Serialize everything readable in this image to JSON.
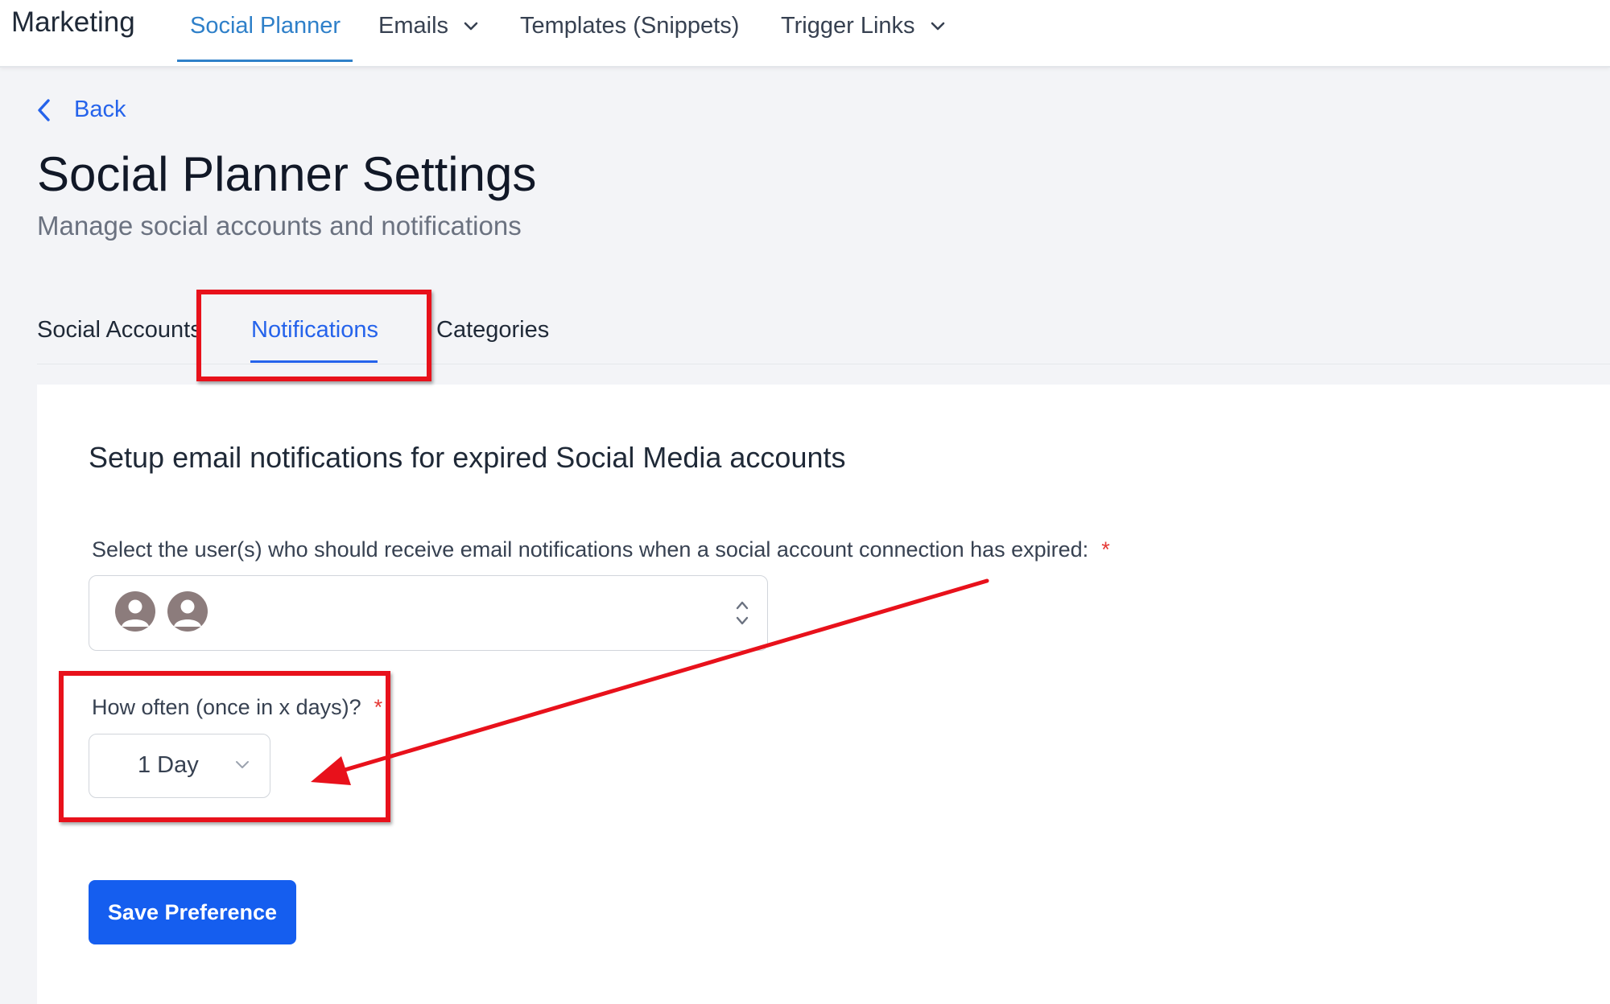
{
  "topbar": {
    "app_title": "Marketing",
    "nav": [
      {
        "label": "Social Planner",
        "active": true,
        "has_dropdown": false
      },
      {
        "label": "Emails",
        "active": false,
        "has_dropdown": true
      },
      {
        "label": "Templates (Snippets)",
        "active": false,
        "has_dropdown": false
      },
      {
        "label": "Trigger Links",
        "active": false,
        "has_dropdown": true
      }
    ]
  },
  "back_label": "Back",
  "page": {
    "title": "Social Planner Settings",
    "subtitle": "Manage social accounts and notifications"
  },
  "tabs": [
    {
      "label": "Social Accounts",
      "active": false
    },
    {
      "label": "Notifications",
      "active": true
    },
    {
      "label": "Categories",
      "active": false
    }
  ],
  "notifications": {
    "heading": "Setup email notifications for expired Social Media accounts",
    "users_label": "Select the user(s) who should receive email notifications when a social account connection has expired:",
    "required_mark": "*",
    "selected_user_avatars": [
      "user-avatar-icon",
      "user-avatar-icon"
    ],
    "frequency_label": "How often (once in x days)?",
    "frequency_value": "1 Day",
    "save_label": "Save Preference"
  },
  "colors": {
    "accent": "#2563eb",
    "nav_active": "#2f80c9",
    "button": "#155eef",
    "annotation": "#e8111b",
    "required": "#e53935"
  }
}
